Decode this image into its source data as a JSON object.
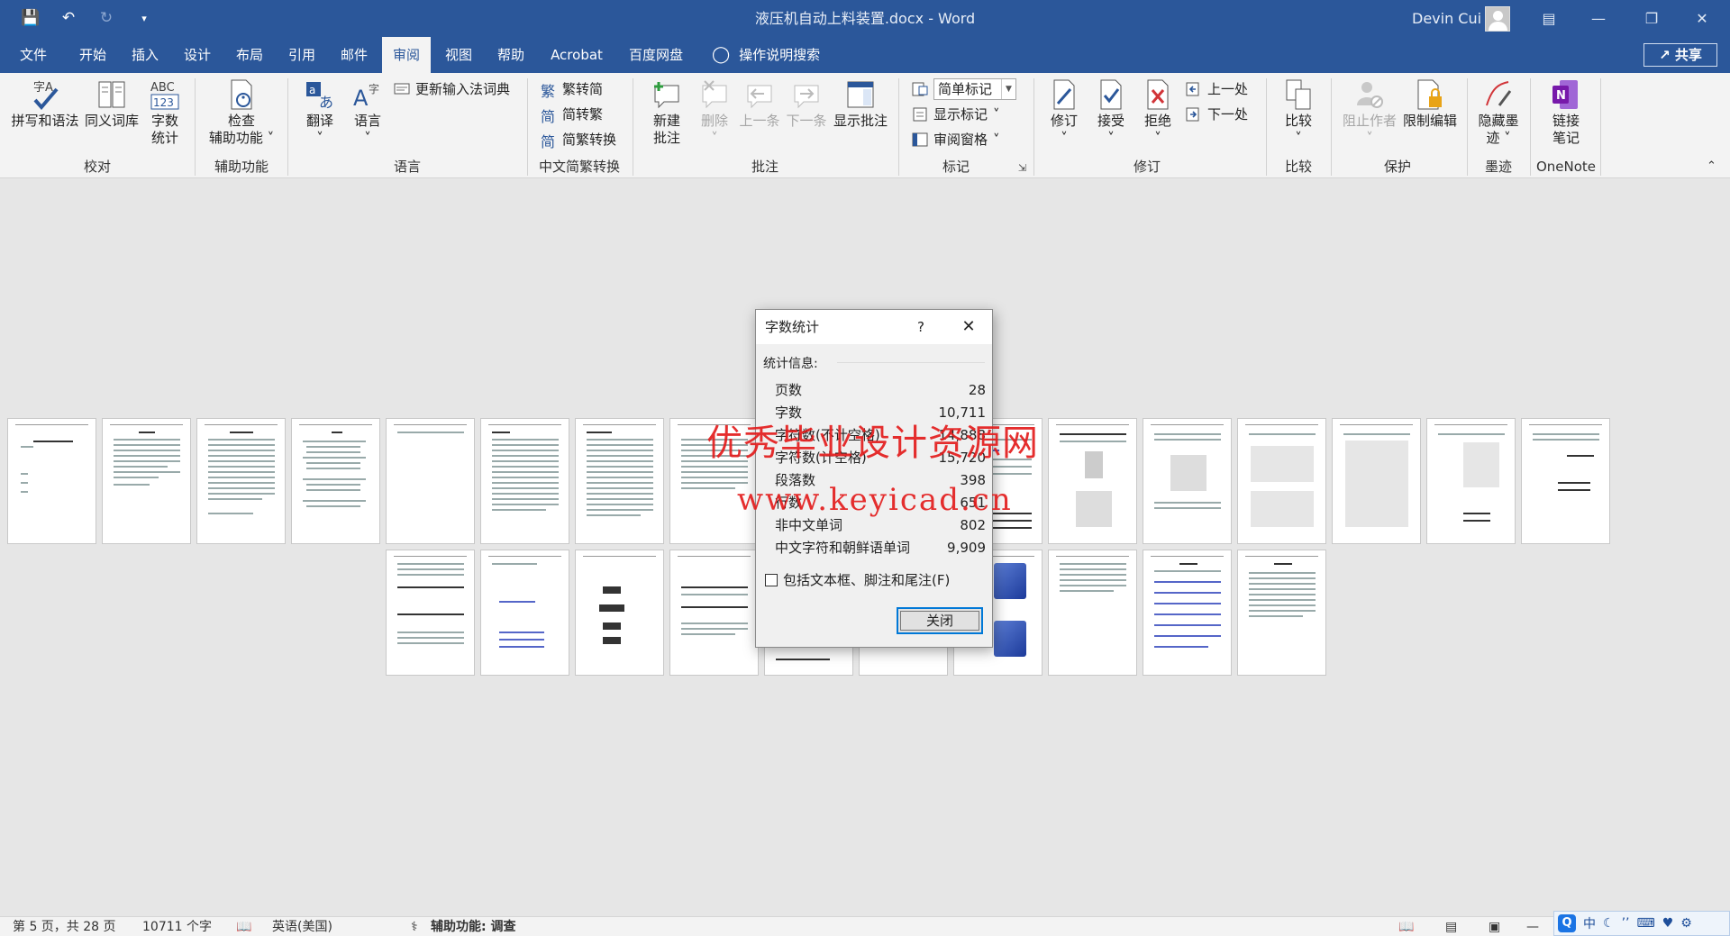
{
  "titlebar": {
    "title": "液压机自动上料装置.docx - Word",
    "user": "Devin Cui",
    "qat_icons": [
      "save-icon",
      "undo-icon",
      "redo-icon",
      "customize-icon"
    ],
    "controls": [
      "ribbon-display-icon",
      "minimize-icon",
      "restore-icon",
      "close-icon"
    ]
  },
  "menu": {
    "tabs": [
      "文件",
      "开始",
      "插入",
      "设计",
      "布局",
      "引用",
      "邮件",
      "审阅",
      "视图",
      "帮助",
      "Acrobat",
      "百度网盘"
    ],
    "active": "审阅",
    "tell_me": "操作说明搜索",
    "share": "共享"
  },
  "ribbon": {
    "proofing": {
      "label": "校对",
      "spelling": "拼写和语法",
      "thesaurus": "同义词库",
      "wordcount_line1": "字数",
      "wordcount_line2": "统计"
    },
    "accessibility": {
      "label": "辅助功能",
      "check_line1": "检查",
      "check_line2": "辅助功能"
    },
    "language": {
      "label": "语言",
      "translate": "翻译",
      "language": "语言",
      "update_ime": "更新输入法词典"
    },
    "chinese_conversion": {
      "label": "中文简繁转换",
      "to_simplified": "繁转简",
      "to_traditional": "简转繁",
      "convert": "简繁转换"
    },
    "comments": {
      "label": "批注",
      "new_line1": "新建",
      "new_line2": "批注",
      "delete": "删除",
      "previous": "上一条",
      "next": "下一条",
      "show": "显示批注"
    },
    "markup": {
      "label": "标记",
      "mode": "简单标记",
      "show_markup": "显示标记",
      "reviewing_pane": "审阅窗格"
    },
    "tracking": {
      "label": "修订",
      "track": "修订",
      "accept": "接受",
      "reject": "拒绝",
      "previous": "上一处",
      "next": "下一处"
    },
    "compare": {
      "label": "比较",
      "compare": "比较"
    },
    "protect": {
      "label": "保护",
      "block_authors": "阻止作者",
      "restrict": "限制编辑"
    },
    "ink": {
      "label": "墨迹",
      "hide_line1": "隐藏墨",
      "hide_line2": "迹"
    },
    "onenote": {
      "label": "OneNote",
      "link_line1": "链接",
      "link_line2": "笔记"
    }
  },
  "watermark": {
    "line1": "优秀毕业设计资源网",
    "line2": "www.keyicad.cn"
  },
  "dialog": {
    "title": "字数统计",
    "help": "?",
    "stats_header": "统计信息:",
    "rows": [
      {
        "label": "页数",
        "value": "28"
      },
      {
        "label": "字数",
        "value": "10,711"
      },
      {
        "label": "字符数(不计空格)",
        "value": "14,888"
      },
      {
        "label": "字符数(计空格)",
        "value": "15,720"
      },
      {
        "label": "段落数",
        "value": "398"
      },
      {
        "label": "行数",
        "value": "651"
      },
      {
        "label": "非中文单词",
        "value": "802"
      },
      {
        "label": "中文字符和朝鲜语单词",
        "value": "9,909"
      }
    ],
    "include_label": "包括文本框、脚注和尾注(F)",
    "include_checked": false,
    "close": "关闭"
  },
  "status": {
    "page": "第 5 页，共 28 页",
    "words": "10711 个字",
    "language": "英语(美国)",
    "accessibility": "辅助功能: 调查"
  },
  "ime": {
    "mode": "中",
    "logo": "Q"
  }
}
